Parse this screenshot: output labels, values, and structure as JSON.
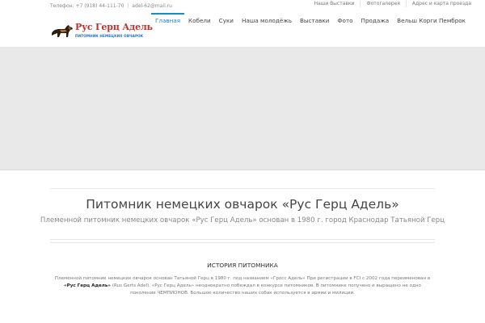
{
  "topbar": {
    "phone": "Телефон: +7 (918) 44-111-70",
    "separator": "|",
    "email": "adel-62@mail.ru",
    "links": [
      "Наши Выставки",
      "Фотогалерея",
      "Адрес и карта проезда"
    ]
  },
  "logo": {
    "title": "Рус Герц Адель",
    "subtitle": "ПИТОМНИК НЕМЕЦКИХ ОВЧАРОК",
    "icon": "german-shepherd-icon"
  },
  "nav": {
    "items": [
      "Главная",
      "Кобели",
      "Суки",
      "Наша молодёжь",
      "Выставки",
      "Фото",
      "Продажа",
      "Вельш Корги Пемброк"
    ],
    "active_index": 0
  },
  "main": {
    "heading": "Питомник немецких овчарок «Рус Герц Адель»",
    "subheading": "Племенной питомник немецких овчарок «Рус Герц Адель» основан  в 1980 г. город Краснодар Татьяной Герц",
    "section_title": "ИСТОРИЯ ПИТОМНИКА",
    "body": {
      "part1": "Племенной питомник немецких овчарок основан Татьяной Герц в 1980 г. под названием «Гросс Адель» При регистрации в FCI с 2002 года переименован в",
      "strong": "«Рус Герц Адель»",
      "part2": "(Rus Gerts Adel). «Рус Герц Адель» неоднократно побеждал в конкурсе питомников. В питомнике получено и выращено не одно поколение ЧЕМПИОНОВ. Большое количество наших собак используется в армии и милиции."
    }
  },
  "colors": {
    "accent": "#1a8bc9",
    "logo_red": "#c0312b",
    "logo_blue": "#1d6fb8",
    "hero_bg": "#e9e9e9"
  }
}
